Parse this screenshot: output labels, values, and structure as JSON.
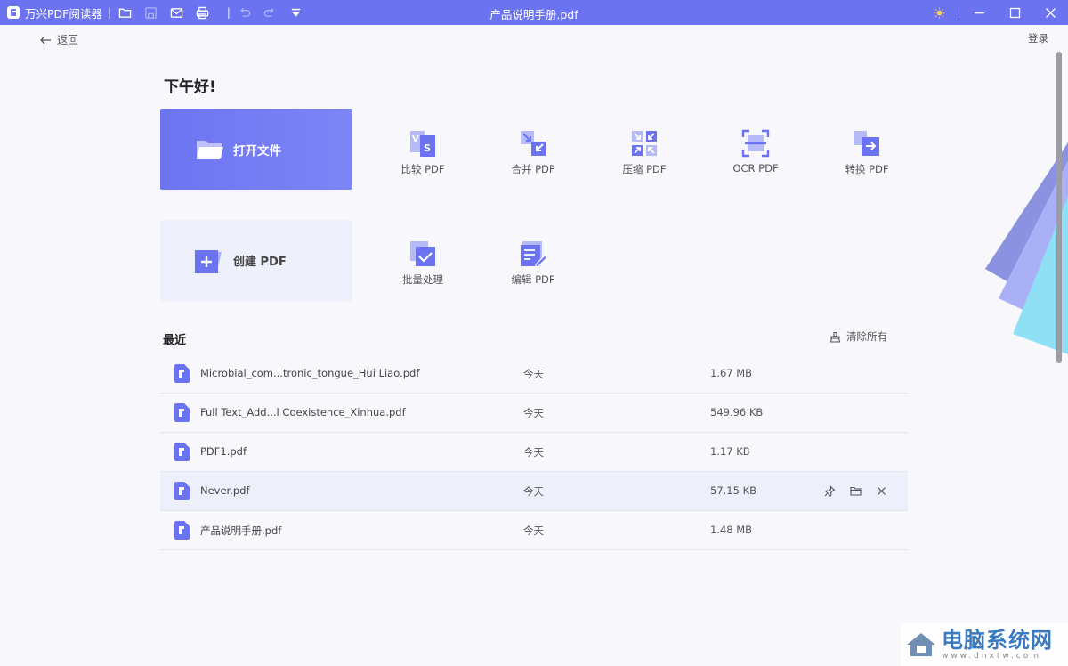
{
  "titlebar": {
    "app_name": "万兴PDF阅读器",
    "separator": "|",
    "document_title": "产品说明手册.pdf",
    "accent_color": "#6b73f0",
    "tools": [
      "folder-icon",
      "save-icon",
      "mail-icon",
      "print-icon",
      "undo-icon",
      "redo-icon",
      "quick-access-dropdown-icon"
    ],
    "window_controls": [
      "theme-sun-icon",
      "minimize-icon",
      "maximize-icon",
      "close-icon"
    ]
  },
  "nav": {
    "back_label": "返回",
    "login_label": "登录"
  },
  "greeting": "下午好!",
  "actions": {
    "open_file": "打开文件",
    "create_pdf": "创建 PDF",
    "compare_pdf": "比较 PDF",
    "merge_pdf": "合并 PDF",
    "compress_pdf": "压缩 PDF",
    "ocr_pdf": "OCR PDF",
    "convert_pdf": "转换 PDF",
    "batch_process": "批量处理",
    "edit_pdf": "编辑 PDF"
  },
  "recent": {
    "title": "最近",
    "clear_all": "清除所有",
    "files": [
      {
        "name": "Microbial_com...tronic_tongue_Hui Liao.pdf",
        "date": "今天",
        "size": "1.67 MB"
      },
      {
        "name": "Full Text_Add...l Coexistence_Xinhua.pdf",
        "date": "今天",
        "size": "549.96 KB"
      },
      {
        "name": "PDF1.pdf",
        "date": "今天",
        "size": "1.17 KB"
      },
      {
        "name": "Never.pdf",
        "date": "今天",
        "size": "57.15 KB",
        "hovered": true,
        "row_actions": [
          "pin-icon",
          "open-folder-icon",
          "remove-icon"
        ]
      },
      {
        "name": "产品说明手册.pdf",
        "date": "今天",
        "size": "1.48 MB"
      }
    ]
  },
  "watermark": {
    "title": "电脑系统网",
    "url": "www.dnxtw.com"
  }
}
